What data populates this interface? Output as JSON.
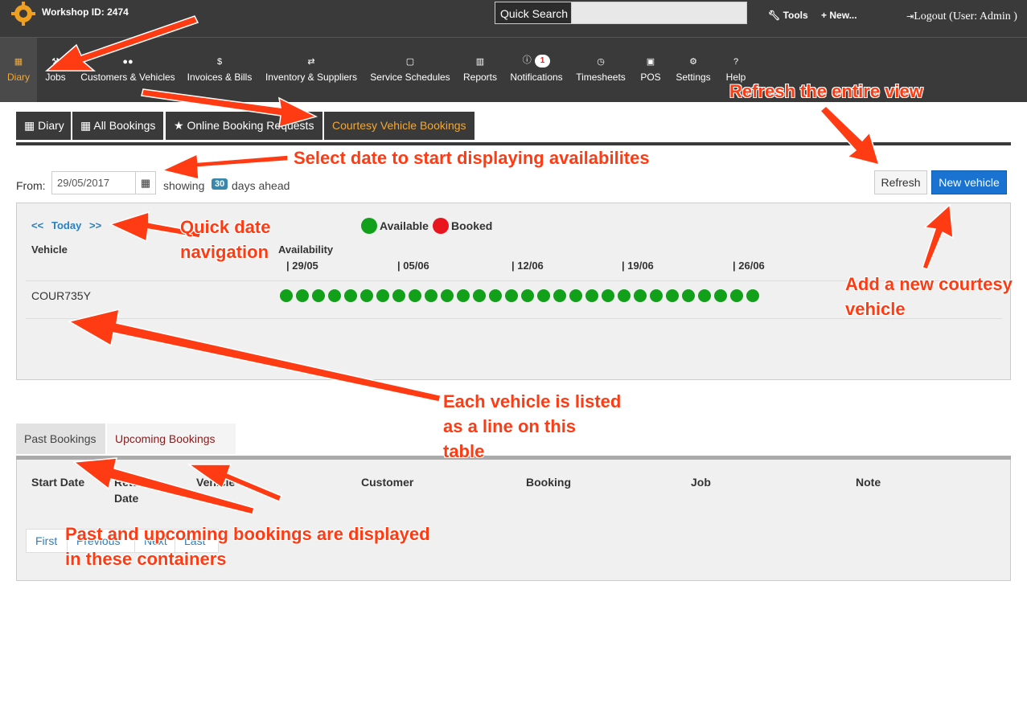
{
  "topbar": {
    "workshop_id": "Workshop ID: 2474",
    "quick_search_label": "Quick Search",
    "quick_search_value": "",
    "tools": "Tools",
    "new": "New...",
    "logout": "Logout (User: Admin )"
  },
  "nav": {
    "items": [
      {
        "label": "Diary",
        "icon": "calendar-icon",
        "active": true
      },
      {
        "label": "Jobs",
        "icon": "wrench-icon"
      },
      {
        "label": "Customers & Vehicles",
        "icon": "users-icon"
      },
      {
        "label": "Invoices & Bills",
        "icon": "dollar-icon"
      },
      {
        "label": "Inventory & Suppliers",
        "icon": "retweet-icon"
      },
      {
        "label": "Service Schedules",
        "icon": "calendar-icon"
      },
      {
        "label": "Reports",
        "icon": "bar-chart-icon"
      },
      {
        "label": "Notifications",
        "icon": "info-icon",
        "badge": "1"
      },
      {
        "label": "Timesheets",
        "icon": "clock-icon"
      },
      {
        "label": "POS",
        "icon": "money-icon"
      },
      {
        "label": "Settings",
        "icon": "cogs-icon"
      },
      {
        "label": "Help",
        "icon": "question-icon"
      }
    ]
  },
  "subtabs": [
    {
      "label": "Diary",
      "icon": "calendar-icon"
    },
    {
      "label": "All Bookings",
      "icon": "calendar-icon"
    },
    {
      "label": "Online Booking Requests",
      "icon": "star-icon"
    },
    {
      "label": "Courtesy Vehicle Bookings",
      "active": true
    }
  ],
  "filter": {
    "from_label": "From:",
    "date_value": "29/05/2017",
    "showing": "showing",
    "days": "30",
    "days_ahead": "days ahead",
    "refresh": "Refresh",
    "new_vehicle": "New vehicle"
  },
  "availability": {
    "prev": "<<",
    "today": "Today",
    "next": ">>",
    "legend_available": "Available",
    "legend_booked": "Booked",
    "available_color": "#12a01a",
    "booked_color": "#e8141e",
    "vehicle_header": "Vehicle",
    "availability_header": "Availability",
    "weeks": [
      "| 29/05",
      "| 05/06",
      "| 12/06",
      "| 19/06",
      "| 26/06"
    ],
    "vehicles": [
      {
        "name": "COUR735Y",
        "slots": 30,
        "status": "available"
      }
    ]
  },
  "bookings": {
    "tab_past": "Past Bookings",
    "tab_upcoming": "Upcoming Bookings",
    "headers": [
      "Start Date",
      "Return Date",
      "Vehicle",
      "Customer",
      "Booking",
      "Job",
      "Note"
    ],
    "pager": [
      "First",
      "Previous",
      "Next",
      "Last"
    ]
  },
  "annotations": {
    "refresh": "Refresh the entire view",
    "select_date": "Select date to start displaying availabilites",
    "quick_nav_1": "Quick date",
    "quick_nav_2": "navigation",
    "add_vehicle_1": "Add a new courtesy",
    "add_vehicle_2": "vehicle",
    "each_vehicle_1": "Each vehicle is listed",
    "each_vehicle_2": "as a line on this",
    "each_vehicle_3": "table",
    "containers_1": "Past and upcoming bookings are displayed",
    "containers_2": "in these containers"
  }
}
